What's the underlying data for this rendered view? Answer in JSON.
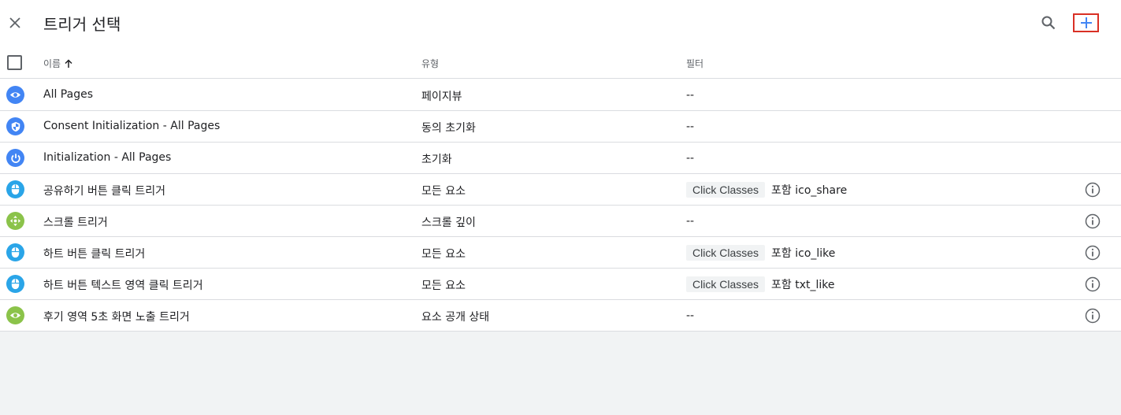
{
  "dialog": {
    "title": "트리거 선택",
    "close_icon": "close-icon",
    "search_icon": "search-icon",
    "add_icon": "plus-icon"
  },
  "table": {
    "headers": {
      "name": "이름",
      "type": "유형",
      "filter": "필터"
    },
    "sort": "ascending",
    "rows": [
      {
        "icon": "pageview-eye-icon",
        "color": "#4285f4",
        "name": "All Pages",
        "type": "페이지뷰",
        "filter_empty": "--"
      },
      {
        "icon": "consent-shield-icon",
        "color": "#4285f4",
        "name": "Consent Initialization - All Pages",
        "type": "동의 초기화",
        "filter_empty": "--"
      },
      {
        "icon": "power-icon",
        "color": "#4285f4",
        "name": "Initialization - All Pages",
        "type": "초기화",
        "filter_empty": "--"
      },
      {
        "icon": "mouse-click-icon",
        "color": "#2aa5e8",
        "name": "공유하기 버튼 클릭 트리거",
        "type": "모든 요소",
        "filter_var": "Click Classes",
        "filter_cond": "포함 ico_share"
      },
      {
        "icon": "scroll-arrows-icon",
        "color": "#8bc34a",
        "name": "스크롤 트리거",
        "type": "스크롤 깊이",
        "filter_empty": "--"
      },
      {
        "icon": "mouse-click-icon",
        "color": "#2aa5e8",
        "name": "하트 버튼 클릭 트리거",
        "type": "모든 요소",
        "filter_var": "Click Classes",
        "filter_cond": "포함 ico_like"
      },
      {
        "icon": "mouse-click-icon",
        "color": "#2aa5e8",
        "name": "하트 버튼 텍스트 영역 클릭 트리거",
        "type": "모든 요소",
        "filter_var": "Click Classes",
        "filter_cond": "포함 txt_like"
      },
      {
        "icon": "visibility-eye-icon",
        "color": "#8bc34a",
        "name": "후기 영역 5초 화면 노출 트리거",
        "type": "요소 공개 상태",
        "filter_empty": "--"
      }
    ]
  },
  "colors": {
    "accent": "#4285f4",
    "highlight_border": "#d93025"
  }
}
